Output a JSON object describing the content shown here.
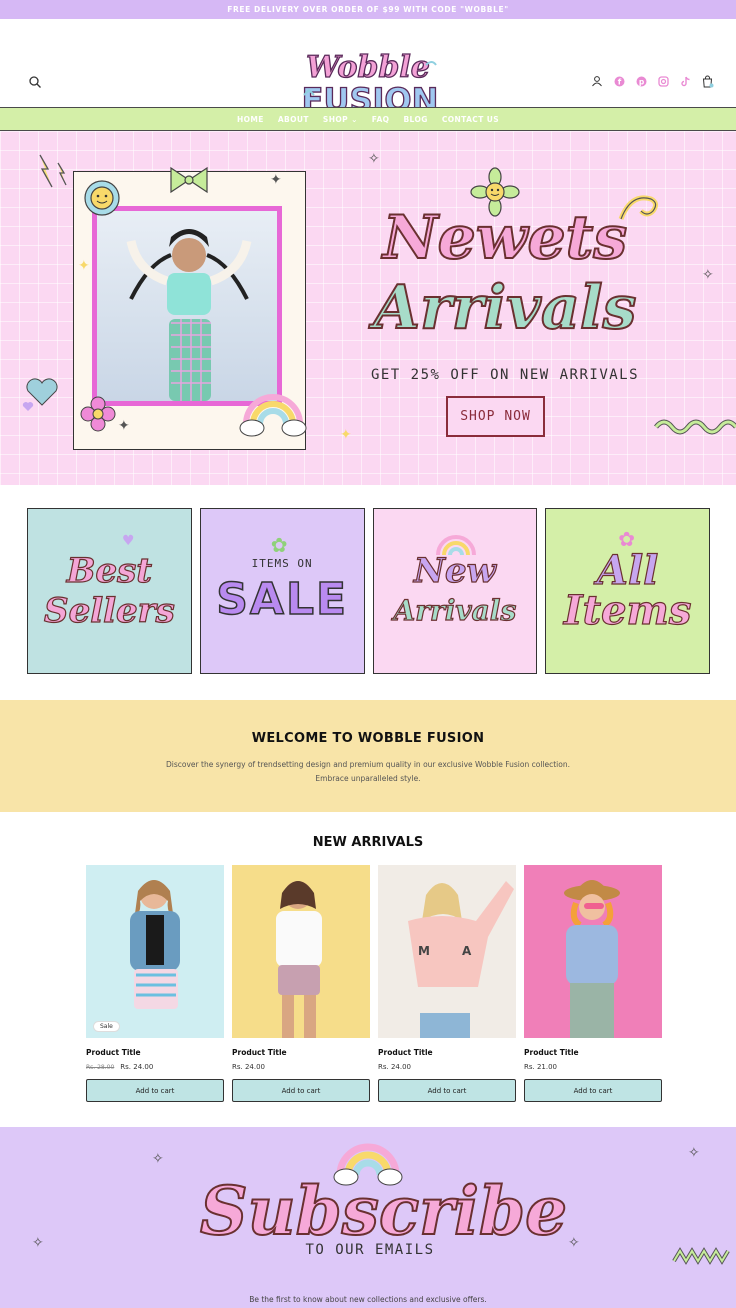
{
  "announcement": "FREE DELIVERY OVER ORDER OF $99 WITH CODE \"WOBBLE\"",
  "brand": {
    "line1": "Wobble",
    "line2": "FUSION"
  },
  "nav": {
    "items": [
      "HOME",
      "ABOUT",
      "SHOP ⌄",
      "FAQ",
      "BLOG",
      "CONTACT US"
    ]
  },
  "header_icons": [
    "account-icon",
    "facebook-icon",
    "pinterest-icon",
    "instagram-icon",
    "tiktok-icon",
    "cart-icon"
  ],
  "hero": {
    "title_line1": "Newets",
    "title_line2": "Arrivals",
    "subtitle": "GET 25% OFF ON NEW ARRIVALS",
    "button": "SHOP NOW"
  },
  "categories": [
    {
      "line1": "Best",
      "line2": "Sellers",
      "bg": "#bfe2e2"
    },
    {
      "small": "ITEMS ON",
      "big": "SALE",
      "bg": "#ddc8f8"
    },
    {
      "line1": "New",
      "line2": "Arrivals",
      "bg": "#fbd8f2"
    },
    {
      "line1": "All",
      "line2": "Items",
      "bg": "#d4efa8"
    }
  ],
  "welcome": {
    "title": "WELCOME TO WOBBLE FUSION",
    "text1": "Discover the synergy of trendsetting design and premium quality in our exclusive Wobble Fusion collection.",
    "text2": "Embrace unparalleled style."
  },
  "new_arrivals": {
    "title": "NEW ARRIVALS",
    "products": [
      {
        "title": "Product Title",
        "old_price": "Rs. 28.00",
        "price": "Rs. 24.00",
        "badge": "Sale",
        "button": "Add to cart",
        "bg": "#cfeef2"
      },
      {
        "title": "Product Title",
        "price": "Rs. 24.00",
        "button": "Add to cart",
        "bg": "#f6dd8a"
      },
      {
        "title": "Product Title",
        "price": "Rs. 24.00",
        "button": "Add to cart",
        "bg": "#f1ece6"
      },
      {
        "title": "Product Title",
        "price": "Rs. 21.00",
        "button": "Add to cart",
        "bg": "#f07fb8"
      }
    ]
  },
  "subscribe": {
    "title": "Subscribe",
    "subtitle": "TO OUR EMAILS",
    "description": "Be the first to know about new collections and exclusive offers."
  },
  "colors": {
    "announcement": "#d6b8f5",
    "nav": "#d4efa8",
    "hero_bg": "#fbd8f2",
    "welcome_bg": "#f8e4a8",
    "subscribe_bg": "#ddc8f8",
    "cart_button": "#bfe4e4"
  }
}
